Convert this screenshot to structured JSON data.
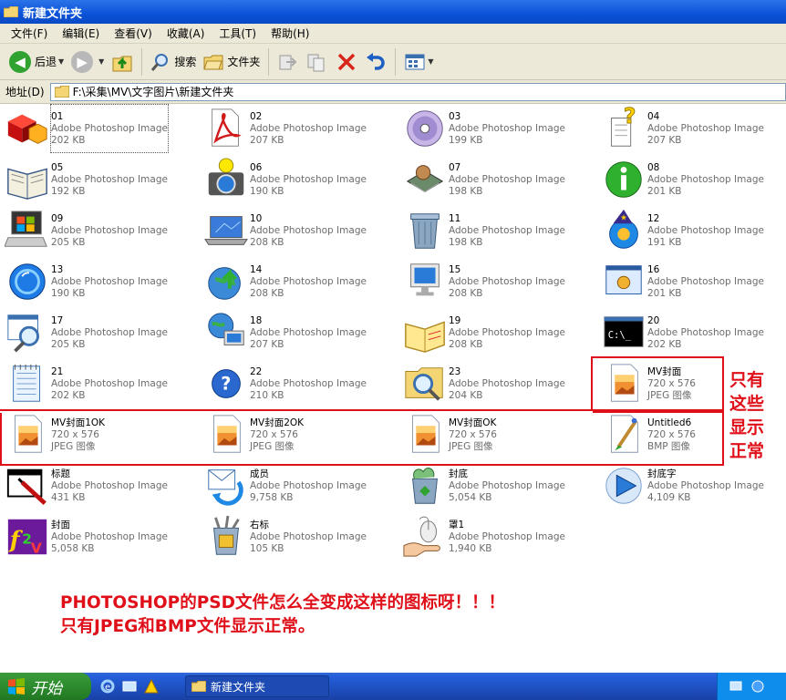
{
  "window": {
    "title": "新建文件夹"
  },
  "menu": [
    "文件(F)",
    "编辑(E)",
    "查看(V)",
    "收藏(A)",
    "工具(T)",
    "帮助(H)"
  ],
  "toolbar": {
    "back_label": "后退",
    "search_label": "搜索",
    "folders_label": "文件夹"
  },
  "address": {
    "label": "地址(D)",
    "path": "F:\\采集\\MV\\文字图片\\新建文件夹"
  },
  "files": [
    {
      "name": "01",
      "type": "Adobe Photoshop Image",
      "size": "202 KB",
      "icon": "red-cubes-icon"
    },
    {
      "name": "02",
      "type": "Adobe Photoshop Image",
      "size": "207 KB",
      "icon": "pdf-document-icon"
    },
    {
      "name": "03",
      "type": "Adobe Photoshop Image",
      "size": "199 KB",
      "icon": "cd-disc-icon"
    },
    {
      "name": "04",
      "type": "Adobe Photoshop Image",
      "size": "207 KB",
      "icon": "help-question-doc-icon"
    },
    {
      "name": "05",
      "type": "Adobe Photoshop Image",
      "size": "192 KB",
      "icon": "open-book-icon"
    },
    {
      "name": "06",
      "type": "Adobe Photoshop Image",
      "size": "190 KB",
      "icon": "camera-icon"
    },
    {
      "name": "07",
      "type": "Adobe Photoshop Image",
      "size": "198 KB",
      "icon": "circuit-chip-icon"
    },
    {
      "name": "08",
      "type": "Adobe Photoshop Image",
      "size": "201 KB",
      "icon": "info-green-icon"
    },
    {
      "name": "09",
      "type": "Adobe Photoshop Image",
      "size": "205 KB",
      "icon": "windows-computer-icon"
    },
    {
      "name": "10",
      "type": "Adobe Photoshop Image",
      "size": "208 KB",
      "icon": "laptop-icon"
    },
    {
      "name": "11",
      "type": "Adobe Photoshop Image",
      "size": "198 KB",
      "icon": "recycle-bin-icon"
    },
    {
      "name": "12",
      "type": "Adobe Photoshop Image",
      "size": "191 KB",
      "icon": "wizard-globe-icon"
    },
    {
      "name": "13",
      "type": "Adobe Photoshop Image",
      "size": "190 KB",
      "icon": "blue-globe-icon"
    },
    {
      "name": "14",
      "type": "Adobe Photoshop Image",
      "size": "208 KB",
      "icon": "globe-up-arrow-icon"
    },
    {
      "name": "15",
      "type": "Adobe Photoshop Image",
      "size": "208 KB",
      "icon": "monitor-icon"
    },
    {
      "name": "16",
      "type": "Adobe Photoshop Image",
      "size": "201 KB",
      "icon": "control-panel-icon"
    },
    {
      "name": "17",
      "type": "Adobe Photoshop Image",
      "size": "205 KB",
      "icon": "search-window-icon"
    },
    {
      "name": "18",
      "type": "Adobe Photoshop Image",
      "size": "207 KB",
      "icon": "network-globe-computer-icon"
    },
    {
      "name": "19",
      "type": "Adobe Photoshop Image",
      "size": "208 KB",
      "icon": "yellow-book-icon"
    },
    {
      "name": "20",
      "type": "Adobe Photoshop Image",
      "size": "202 KB",
      "icon": "command-prompt-icon"
    },
    {
      "name": "21",
      "type": "Adobe Photoshop Image",
      "size": "202 KB",
      "icon": "notepad-icon"
    },
    {
      "name": "22",
      "type": "Adobe Photoshop Image",
      "size": "210 KB",
      "icon": "help-circle-icon"
    },
    {
      "name": "23",
      "type": "Adobe Photoshop Image",
      "size": "204 KB",
      "icon": "folder-search-icon"
    },
    {
      "name": "MV封面",
      "type": "720 x 576",
      "size": "JPEG 图像",
      "icon": "jpeg-image-icon"
    },
    {
      "name": "MV封面1OK",
      "type": "720 x 576",
      "size": "JPEG 图像",
      "icon": "jpeg-image-icon"
    },
    {
      "name": "MV封面2OK",
      "type": "720 x 576",
      "size": "JPEG 图像",
      "icon": "jpeg-image-icon"
    },
    {
      "name": "MV封面OK",
      "type": "720 x 576",
      "size": "JPEG 图像",
      "icon": "jpeg-image-icon"
    },
    {
      "name": "Untitled6",
      "type": "720 x 576",
      "size": "BMP 图像",
      "icon": "bmp-paint-icon"
    },
    {
      "name": "标题",
      "type": "Adobe Photoshop Image",
      "size": "431 KB",
      "icon": "window-pen-icon"
    },
    {
      "name": "成员",
      "type": "Adobe Photoshop Image",
      "size": "9,758 KB",
      "icon": "mail-exchange-icon"
    },
    {
      "name": "封底",
      "type": "Adobe Photoshop Image",
      "size": "5,054 KB",
      "icon": "recycle-full-icon"
    },
    {
      "name": "封底字",
      "type": "Adobe Photoshop Image",
      "size": "4,109 KB",
      "icon": "play-arrow-icon"
    },
    {
      "name": "封面",
      "type": "Adobe Photoshop Image",
      "size": "5,058 KB",
      "icon": "f2v-logo-icon"
    },
    {
      "name": "右标",
      "type": "Adobe Photoshop Image",
      "size": "105 KB",
      "icon": "trash-tools-icon"
    },
    {
      "name": "罩1",
      "type": "Adobe Photoshop Image",
      "size": "1,940 KB",
      "icon": "hand-mouse-icon"
    }
  ],
  "annotation": {
    "side": [
      "只有",
      "这些",
      "显示",
      "正常"
    ],
    "line1": "PHOTOSHOP的PSD文件怎么全变成这样的图标呀！！！",
    "line2": "只有JPEG和BMP文件显示正常。",
    "color": "#e0101a"
  },
  "taskbar": {
    "start_label": "开始",
    "window_label": "新建文件夹"
  }
}
